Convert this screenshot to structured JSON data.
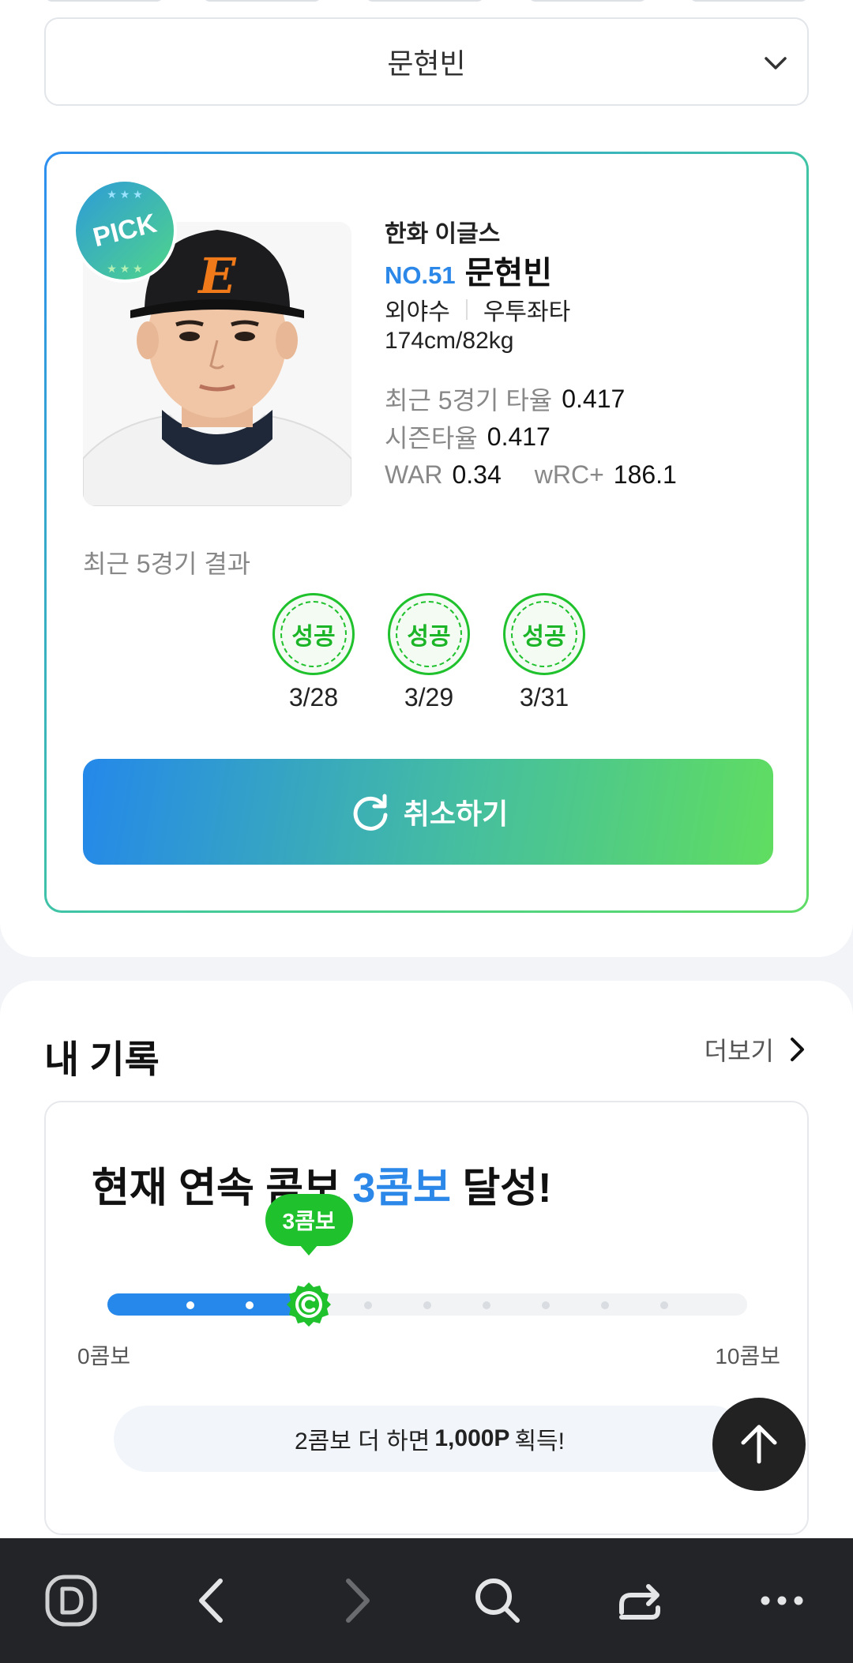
{
  "player_select": {
    "value": "문현빈"
  },
  "player": {
    "badge": "PICK",
    "team": "한화 이글스",
    "number": "NO.51",
    "name": "문현빈",
    "position": "외야수",
    "bats_throws": "우투좌타",
    "body": "174cm/82kg",
    "recent5_avg_label": "최근 5경기 타율",
    "recent5_avg": "0.417",
    "season_avg_label": "시즌타율",
    "season_avg": "0.417",
    "war_label": "WAR",
    "war": "0.34",
    "wrc_label": "wRC+",
    "wrc": "186.1"
  },
  "recent_results": {
    "label": "최근 5경기 결과",
    "items": [
      {
        "result": "성공",
        "date": "3/28"
      },
      {
        "result": "성공",
        "date": "3/29"
      },
      {
        "result": "성공",
        "date": "3/31"
      }
    ]
  },
  "cancel_button": {
    "label": "취소하기"
  },
  "my_record": {
    "title": "내 기록",
    "more_label": "더보기",
    "headline_prefix": "현재 연속 콤보 ",
    "headline_accent": "3콤보",
    "headline_suffix": " 달성!",
    "current_combo_label": "3콤보",
    "current_combo": 3,
    "max_combo": 10,
    "range_min": "0콤보",
    "range_max": "10콤보",
    "reward_prefix": "2콤보 더 하면",
    "reward_amount": "1,000P",
    "reward_suffix": "획득!"
  },
  "colors": {
    "accent_blue": "#2b87e8",
    "success_green": "#1fc12c",
    "bottom_bar": "#232427"
  },
  "browser_bar": {
    "icons": [
      "d-logo-icon",
      "back-arrow-icon",
      "forward-arrow-icon",
      "search-icon",
      "share-icon",
      "more-icon"
    ]
  }
}
